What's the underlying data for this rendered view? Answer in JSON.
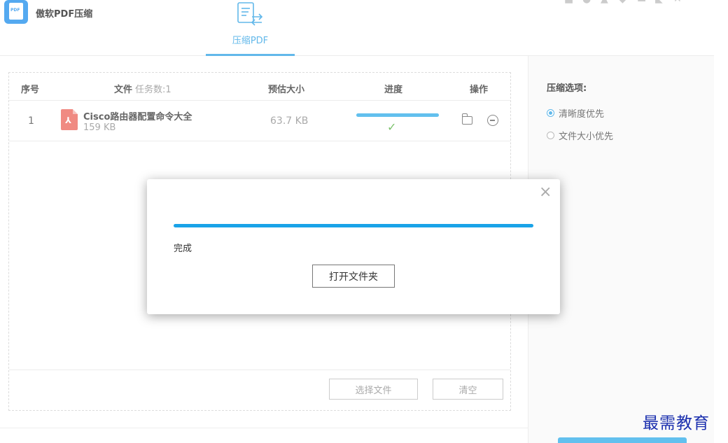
{
  "app": {
    "title": "傲软PDF压缩",
    "logo_text": "PDF"
  },
  "window_controls": [
    "cart-icon",
    "user-icon",
    "bell-icon",
    "heart-icon",
    "minimize-icon",
    "restore-icon",
    "close-icon"
  ],
  "tabs": [
    {
      "label": "压缩PDF",
      "active": true,
      "icon": "compress-doc-icon"
    }
  ],
  "table": {
    "headers": {
      "index": "序号",
      "file": "文件",
      "task_count": "任务数:1",
      "estimated_size": "预估大小",
      "progress": "进度",
      "actions": "操作"
    },
    "rows": [
      {
        "index": "1",
        "name": "Cisco路由器配置命令大全",
        "size": "159 KB",
        "estimated": "63.7 KB",
        "progress": 1.0,
        "status_icon": "check-icon"
      }
    ],
    "select_button": "选择文件",
    "clear_button": "清空"
  },
  "sidebar": {
    "title": "压缩选项:",
    "options": [
      {
        "label": "清晰度优先",
        "selected": true
      },
      {
        "label": "文件大小优先",
        "selected": false
      }
    ]
  },
  "dialog": {
    "progress": 1.0,
    "status": "完成",
    "open_button": "打开文件夹"
  },
  "watermark": "最需教育",
  "colors": {
    "accent": "#62b8ea",
    "dialog_bar": "#1aa3e8",
    "pdf_icon": "#f08a82",
    "check": "#7cc26c"
  }
}
